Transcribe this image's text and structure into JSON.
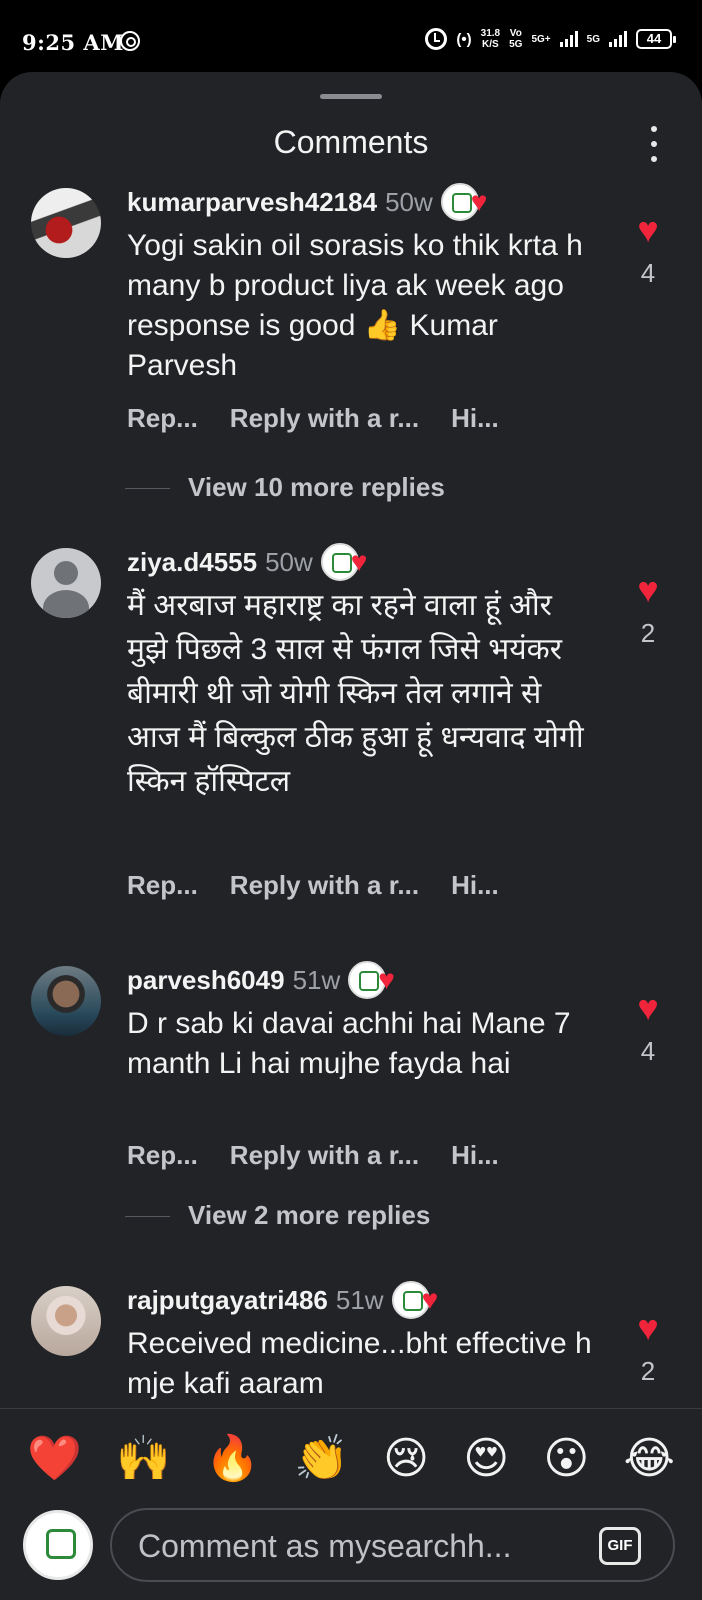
{
  "status_bar": {
    "time": "9:25 AM",
    "speed_value": "31.8",
    "speed_unit": "K/S",
    "network_1_top": "Vo",
    "network_1_bottom": "5G",
    "network_1_tech": "5G+",
    "network_2_tech": "5G",
    "battery": "44"
  },
  "header": {
    "title": "Comments"
  },
  "comments": [
    {
      "username": "kumarparvesh42184",
      "time": "50w",
      "text": "Yogi sakin oil sorasis ko thik krta h many b product liya ak week ago response is good 👍 Kumar Parvesh",
      "likes": "4",
      "view_replies": "View 10 more replies"
    },
    {
      "username": "ziya.d4555",
      "time": "50w",
      "text": "मैं अरबाज महाराष्ट्र का रहने वाला हूं और मुझे पिछले 3 साल से फंगल जिसे भयंकर बीमारी थी जो योगी स्किन तेल लगाने से आज मैं बिल्कुल ठीक हुआ हूं धन्यवाद योगी स्किन हॉस्पिटल",
      "likes": "2"
    },
    {
      "username": "parvesh6049",
      "time": "51w",
      "text": "D r sab ki davai achhi hai Mane 7 manth Li hai mujhe fayda hai",
      "likes": "4",
      "view_replies": "View 2 more replies"
    },
    {
      "username": "rajputgayatri486",
      "time": "51w",
      "text": "Received medicine...bht effective h mje kafi aaram",
      "likes": "2"
    }
  ],
  "actions": {
    "reply": "Rep...",
    "reply_with": "Reply with a r...",
    "hide": "Hi..."
  },
  "emoji_reactions": [
    "❤️",
    "🙌",
    "🔥",
    "👏",
    "😢",
    "😍",
    "😮",
    "😂"
  ],
  "composer": {
    "placeholder": "Comment as mysearchh...",
    "gif_label": "GIF"
  },
  "colors": {
    "sheet_background": "#222327",
    "like_red": "#f0243b",
    "muted_text": "#9da0a6"
  }
}
